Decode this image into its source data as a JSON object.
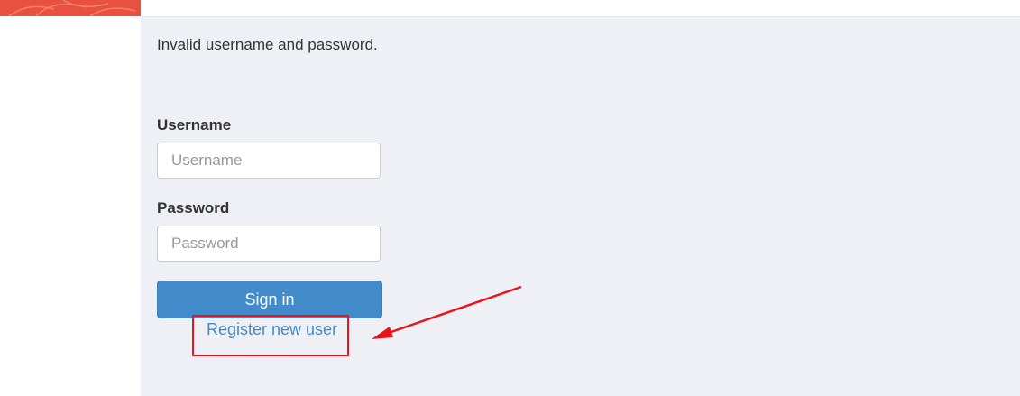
{
  "message": {
    "error": "Invalid username and password."
  },
  "form": {
    "username": {
      "label": "Username",
      "value": "",
      "placeholder": "Username"
    },
    "password": {
      "label": "Password",
      "value": "",
      "placeholder": "Password"
    },
    "signin_label": "Sign in",
    "register_label": "Register new user"
  },
  "colors": {
    "brand": "#e8503f",
    "content_background": "#eff0f5",
    "primary_button": "#428bca",
    "link": "#428bca",
    "annotation": "#e8141b"
  },
  "annotation": {
    "type": "highlight-box-with-arrow",
    "target": "register-link"
  }
}
